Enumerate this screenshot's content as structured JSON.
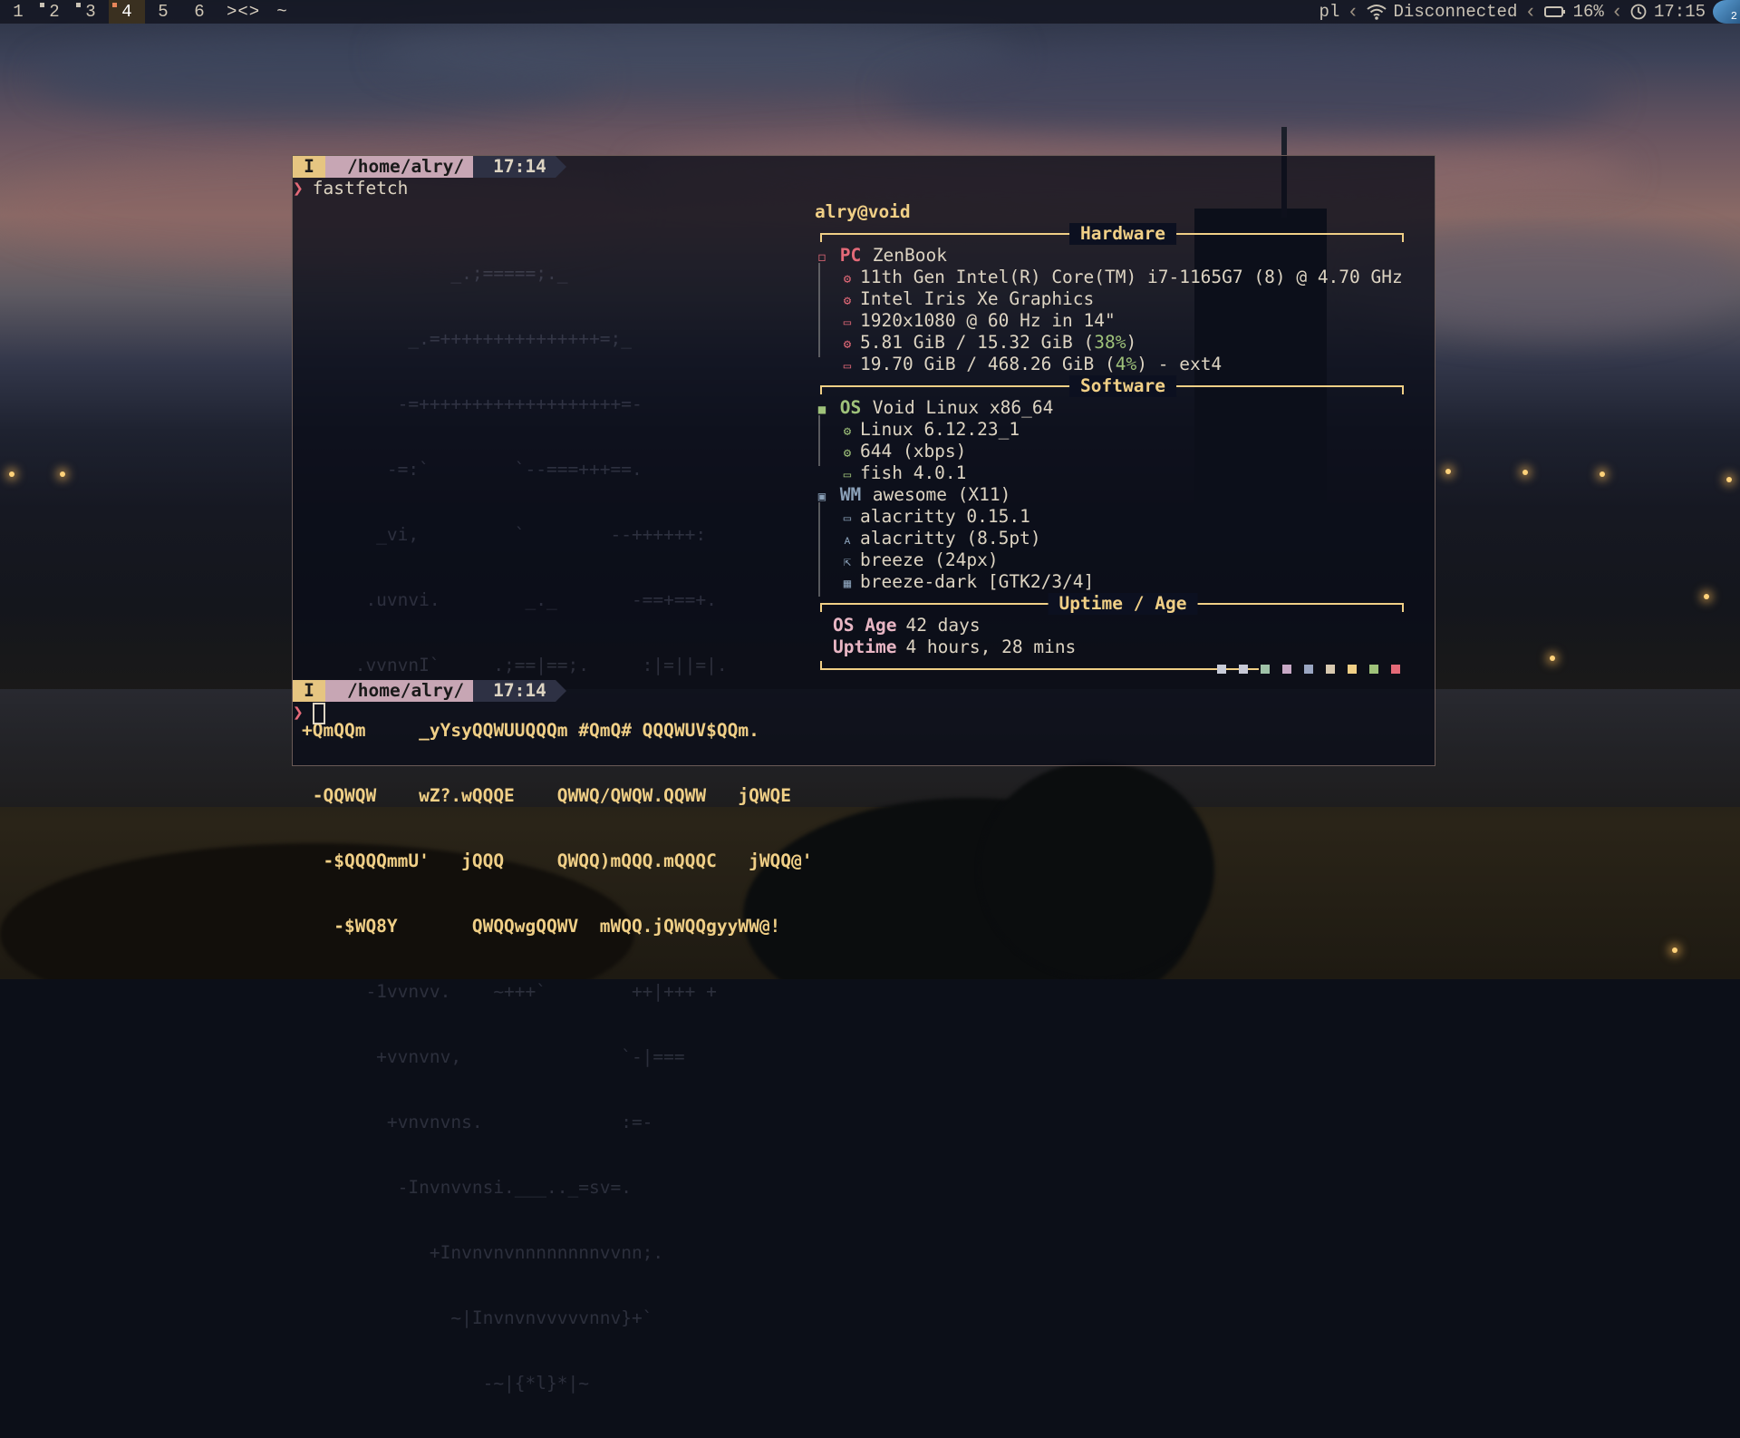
{
  "topbar": {
    "tags": [
      "1",
      "2",
      "3",
      "4",
      "5",
      "6"
    ],
    "focused_tag": "4",
    "layout_symbol": "><>",
    "tilde": "~",
    "keyboard_layout": "pl",
    "network_status": "Disconnected",
    "battery": "16%",
    "clock": "17:15",
    "avatar_badge": "2",
    "icons": [
      "wifi-icon",
      "battery-icon",
      "clock-icon"
    ]
  },
  "terminal": {
    "prompt1": {
      "mode": "I",
      "dir": "/home/alry/",
      "time": "17:14",
      "command": "fastfetch"
    },
    "prompt2": {
      "mode": "I",
      "dir": "/home/alry/",
      "time": "17:14",
      "command": ""
    },
    "prompt_arrow": "❯",
    "ascii_art": {
      "dim_lines": [
        "              _.;=====;._",
        "          _.=+++++++++++++++=;_",
        "         -=+++++++++++++++++++=-",
        "        -=:`        `--===+++==.",
        "       _vi,         `        --++++++:",
        "      .uvnvi.        _._       -==+==+.",
        "     .vvnvnI`     .;==|==;.     :|=||=|."
      ],
      "bright_lines": [
        "+QmQQm     _yYsyQQWUUQQQm #QmQ# QQQWUV$QQm.",
        " -QQWQW    wZ?.wQQQE    QWWQ/QWQW.QQWW   jQWQE",
        "  -$QQQQmmU'   jQQQ     QWQQ)mQQQ.mQQQC   jWQQ@'",
        "   -$WQ8Y       QWQQwgQQWV  mWQQ.jQWQQgyyWW@!"
      ],
      "dim_lines_bottom": [
        "      -1vvnvv.    ~+++`        ++|+++ +",
        "       +vvnvnv,               `-|===",
        "        +vnvnvns.             :=-",
        "         -Invnvvnsi.___.._=sv=.",
        "            +Invnvnvnnnnnnnnvvnn;.",
        "              ~|Invnvnvvvvvnnv}+`",
        "                 -~|{*l}*|~"
      ]
    },
    "fastfetch": {
      "user_host": "alry@void",
      "sections": {
        "hardware": "Hardware",
        "software": "Software",
        "uptime": "Uptime / Age"
      },
      "pc": {
        "key": "PC",
        "value": "ZenBook"
      },
      "hardware_items": [
        {
          "icon": "cpu-icon",
          "value": "11th Gen Intel(R) Core(TM) i7-1165G7 (8) @ 4.70 GHz"
        },
        {
          "icon": "gpu-icon",
          "value": "Intel Iris Xe Graphics"
        },
        {
          "icon": "display-icon",
          "value": "1920x1080 @ 60 Hz in 14\""
        },
        {
          "icon": "memory-icon",
          "value_pre": "5.81 GiB / 15.32 GiB (",
          "pct": "38%",
          "value_post": ")"
        },
        {
          "icon": "disk-icon",
          "value_pre": "19.70 GiB / 468.26 GiB (",
          "pct": "4%",
          "value_post": ") - ext4"
        }
      ],
      "os": {
        "key": "OS",
        "value": "Void Linux x86_64"
      },
      "software_items": [
        {
          "icon": "kernel-icon",
          "value": "Linux 6.12.23_1"
        },
        {
          "icon": "package-icon",
          "value": "644 (xbps)"
        },
        {
          "icon": "shell-icon",
          "value": "fish 4.0.1"
        }
      ],
      "wm": {
        "key": "WM",
        "value": "awesome (X11)"
      },
      "wm_items": [
        {
          "icon": "terminal-icon",
          "value": "alacritty 0.15.1"
        },
        {
          "icon": "font-icon",
          "value": "alacritty (8.5pt)"
        },
        {
          "icon": "cursor-icon",
          "value": "breeze (24px)"
        },
        {
          "icon": "theme-icon",
          "value": "breeze-dark [GTK2/3/4]"
        }
      ],
      "os_age": {
        "key": "OS Age",
        "value": "42 days"
      },
      "uptime": {
        "key": "Uptime",
        "value": "4 hours, 28 mins"
      },
      "palette": [
        "#c8ccd8",
        "#c7c9d6",
        "#9fc2a8",
        "#c8a9c6",
        "#9aa6c2",
        "#d8c9b0",
        "#f0cf86",
        "#9fc27a",
        "#e46a78"
      ],
      "colors": {
        "accent": "#f0cf86",
        "red": "#e46a78",
        "green": "#9fc27a",
        "pink": "#e8b6c4"
      }
    }
  }
}
